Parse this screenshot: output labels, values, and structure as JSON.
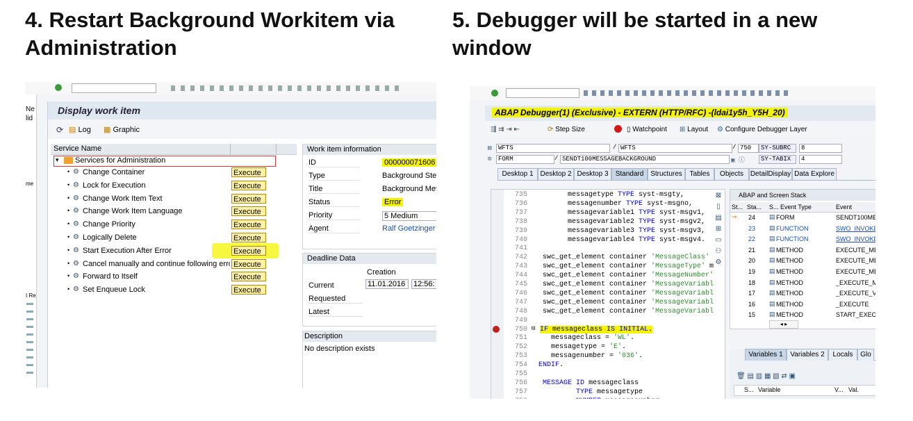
{
  "left_heading": {
    "line1": "4. Restart Background Workitem via",
    "line2": "Administration"
  },
  "right_heading": {
    "line1": "5. Debugger will be started in a new",
    "line2": "window"
  },
  "left_screen": {
    "side_fragments": [
      "Ne",
      "lid",
      "me",
      "I Re"
    ],
    "title": "Display work item",
    "toolbar": {
      "log": "Log",
      "graphic": "Graphic"
    },
    "tree_header": "Service Name",
    "root": "Services for Administration",
    "items": [
      {
        "label": "Change Container",
        "execute": "Execute"
      },
      {
        "label": "Lock for Execution",
        "execute": "Execute"
      },
      {
        "label": "Change Work Item Text",
        "execute": "Execute"
      },
      {
        "label": "Change Work Item Language",
        "execute": "Execute"
      },
      {
        "label": "Change Priority",
        "execute": "Execute"
      },
      {
        "label": "Logically Delete",
        "execute": "Execute"
      },
      {
        "label": "Start Execution After Error",
        "execute": "Execute"
      },
      {
        "label": "Cancel manually and continue following erro",
        "execute": "Execute"
      },
      {
        "label": "Forward to Itself",
        "execute": "Execute"
      },
      {
        "label": "Set Enqueue Lock",
        "execute": "Execute"
      }
    ],
    "info": {
      "header": "Work item information",
      "rows": [
        {
          "label": "ID",
          "value": "000000071606"
        },
        {
          "label": "Type",
          "value": "Background Step"
        },
        {
          "label": "Title",
          "value": "Background Met"
        },
        {
          "label": "Status",
          "value": "Error"
        },
        {
          "label": "Priority",
          "value": "5 Medium"
        },
        {
          "label": "Agent",
          "value": "Ralf Goetzinger"
        }
      ]
    },
    "deadline": {
      "header": "Deadline Data",
      "col": "Creation",
      "current": "Current",
      "date": "11.01.2016",
      "time": "12:56:",
      "requested": "Requested",
      "latest": "Latest"
    },
    "description": {
      "header": "Description",
      "text": "No description exists"
    }
  },
  "right_screen": {
    "title": "ABAP Debugger(1)  (Exclusive) - EXTERN (HTTP/RFC) -(ldai1y5h_Y5H_20)",
    "toolbar": {
      "step_size": "Step Size",
      "watchpoint": "Watchpoint",
      "layout": "Layout",
      "configure": "Configure Debugger Layer"
    },
    "fields": {
      "r1a": "WFTS",
      "r1b": "WFTS",
      "r1c": "750",
      "r1d": "SY-SUBRC",
      "r1e": "8",
      "r2a": "FORM",
      "r2b": "SENDT100MESSAGEBACKGROUND",
      "r2d": "SY-TABIX",
      "r2e": "4"
    },
    "tabs": [
      "Desktop 1",
      "Desktop 2",
      "Desktop 3",
      "Standard",
      "Structures",
      "Tables",
      "Objects",
      "DetailDisplay",
      "Data Explore"
    ],
    "code": [
      {
        "n": "735",
        "t": "        messagetype TYPE syst-msgty,"
      },
      {
        "n": "736",
        "t": "        messagenumber TYPE syst-msgno,"
      },
      {
        "n": "737",
        "t": "        messagevariable1 TYPE syst-msgv1,"
      },
      {
        "n": "738",
        "t": "        messagevariable2 TYPE syst-msgv2,"
      },
      {
        "n": "739",
        "t": "        messagevariable3 TYPE syst-msgv3,"
      },
      {
        "n": "740",
        "t": "        messagevariable4 TYPE syst-msgv4."
      },
      {
        "n": "741",
        "t": ""
      },
      {
        "n": "742",
        "t": "  swc_get_element container 'MessageClass'"
      },
      {
        "n": "743",
        "t": "  swc_get_element container 'MessageType' m"
      },
      {
        "n": "744",
        "t": "  swc_get_element container 'MessageNumber'"
      },
      {
        "n": "745",
        "t": "  swc_get_element container 'MessageVariabl"
      },
      {
        "n": "746",
        "t": "  swc_get_element container 'MessageVariabl"
      },
      {
        "n": "747",
        "t": "  swc_get_element container 'MessageVariabl"
      },
      {
        "n": "748",
        "t": "  swc_get_element container 'MessageVariabl"
      },
      {
        "n": "749",
        "t": ""
      },
      {
        "n": "750",
        "t": "IF messageclass IS INITIAL."
      },
      {
        "n": "751",
        "t": "    messageclass = 'WL'."
      },
      {
        "n": "752",
        "t": "    messagetype = 'E'."
      },
      {
        "n": "753",
        "t": "    messagenumber = '036'."
      },
      {
        "n": "754",
        "t": " ENDIF."
      },
      {
        "n": "755",
        "t": ""
      },
      {
        "n": "756",
        "t": "  MESSAGE ID messageclass"
      },
      {
        "n": "757",
        "t": "          TYPE messagetype"
      },
      {
        "n": "758",
        "t": "          NUMBER messagenumber"
      }
    ],
    "stack": {
      "title": "ABAP and Screen Stack",
      "headers": [
        "St...",
        "Sta...",
        "S...",
        "Event Type",
        "Event"
      ],
      "rows": [
        {
          "n": "24",
          "type": "FORM",
          "event": "SENDT100ME"
        },
        {
          "n": "23",
          "type": "FUNCTION",
          "event": "SWO_INVOKE"
        },
        {
          "n": "22",
          "type": "FUNCTION",
          "event": "SWO_INVOKE"
        },
        {
          "n": "21",
          "type": "METHOD",
          "event": "EXECUTE_ME"
        },
        {
          "n": "20",
          "type": "METHOD",
          "event": "EXECUTE_ME"
        },
        {
          "n": "19",
          "type": "METHOD",
          "event": "EXECUTE_ME"
        },
        {
          "n": "18",
          "type": "METHOD",
          "event": "_EXECUTE_M"
        },
        {
          "n": "17",
          "type": "METHOD",
          "event": "_EXECUTE_VI"
        },
        {
          "n": "16",
          "type": "METHOD",
          "event": "_EXECUTE"
        },
        {
          "n": "15",
          "type": "METHOD",
          "event": "START_EXECU"
        }
      ]
    },
    "var_tabs": [
      "Variables 1",
      "Variables 2",
      "Locals",
      "Glo"
    ],
    "var_headers": [
      "S...",
      "Variable",
      "V...",
      "Val."
    ]
  }
}
